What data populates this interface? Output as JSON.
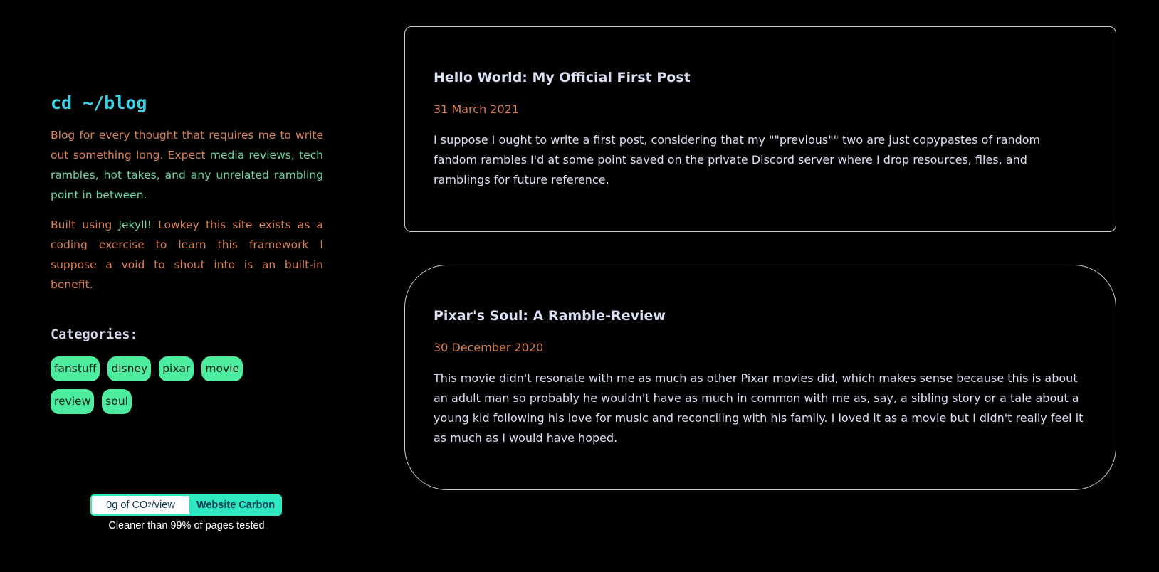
{
  "sidebar": {
    "title": "cd ~/blog",
    "intro_1_a": "Blog for every thought that requires me to write out something long. Expect ",
    "intro_1_b": "media reviews, tech rambles, hot takes, and any unrelated rambling point in between.",
    "intro_2_a": "Built using ",
    "intro_2_b": "Jekyll!",
    "intro_2_c": " Lowkey this site exists as a coding exercise to learn this framework I suppose a void to shout into is an built-in benefit.",
    "categories_heading": "Categories:",
    "tags": [
      "fanstuff",
      "disney",
      "pixar",
      "movie",
      "review",
      "soul"
    ]
  },
  "carbon_badge": {
    "value_prefix": "0g of CO",
    "value_sub": "2",
    "value_suffix": "/view",
    "link_label": "Website Carbon",
    "caption": "Cleaner than 99% of pages tested"
  },
  "posts": [
    {
      "title": "Hello World: My Official First Post",
      "date": "31 March 2021",
      "excerpt": "I suppose I ought to write a first post, considering that my \"\"previous\"\" two are just copypastes of random fandom rambles I'd at some point saved on the private Discord server where I drop resources, files, and ramblings for future reference."
    },
    {
      "title": "Pixar's Soul: A Ramble-Review",
      "date": "30 December 2020",
      "excerpt": "This movie didn't resonate with me as much as other Pixar movies did, which makes sense because this is about an adult man so probably he wouldn't have as much in common with me as, say, a sibling story or a tale about a young kid following his love for music and reconciling with his family. I loved it as a movie but I didn't really feel it as much as I would have hoped."
    }
  ],
  "colors": {
    "background": "#000000",
    "title_cyan": "#3fd2e6",
    "text_orange": "#d98055",
    "text_green": "#6cd3a0",
    "tag_green": "#4ded9f",
    "carbon_teal": "#2ee8bf",
    "post_text": "#dcdff4"
  }
}
